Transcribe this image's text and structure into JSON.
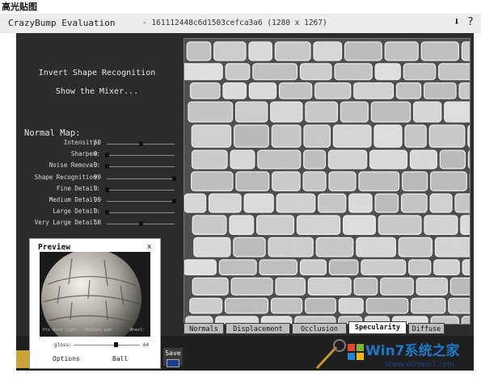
{
  "caption": "高光贴图",
  "app": {
    "title": "CrazyBump Evaluation",
    "file_title": "- 161112448c6d1503cefca3a6 (1280 x 1267)",
    "toolbar_icons": [
      "download-icon",
      "help-icon"
    ]
  },
  "menu": {
    "invert": "Invert Shape Recognition",
    "mixer": "Show the Mixer..."
  },
  "normal_map": {
    "title": "Normal Map:",
    "sliders": [
      {
        "label": "Intensity:",
        "value": "50",
        "level": 0.5
      },
      {
        "label": "Sharpen:",
        "value": "0",
        "level": 0.0
      },
      {
        "label": "Noise Removal:",
        "value": "0",
        "level": 0.0
      },
      {
        "label": "Shape Recognition:",
        "value": "99",
        "level": 0.99
      },
      {
        "label": "Fine Detail:",
        "value": "0",
        "level": 0.0
      },
      {
        "label": "Medium Detail:",
        "value": "99",
        "level": 0.99
      },
      {
        "label": "Large Detail:",
        "value": "0",
        "level": 0.0
      },
      {
        "label": "Very Large Detail:",
        "value": "50",
        "level": 0.5
      }
    ]
  },
  "tabs": [
    "Normals",
    "Displacement",
    "Occlusion",
    "Specularity",
    "Diffuse"
  ],
  "active_tab": "Specularity",
  "save_label": "Save",
  "preview": {
    "title": "Preview",
    "close": "x",
    "hints": [
      "Pts move light",
      "Middles pan",
      "Wheel:"
    ],
    "gloss_label": "gloss:",
    "gloss_value": "64",
    "gloss_level": 0.64,
    "options_label": "Options",
    "ball_label": "Ball"
  },
  "watermark": {
    "brand": "Win7系统之家",
    "url": "Www.Winwin7.com"
  }
}
